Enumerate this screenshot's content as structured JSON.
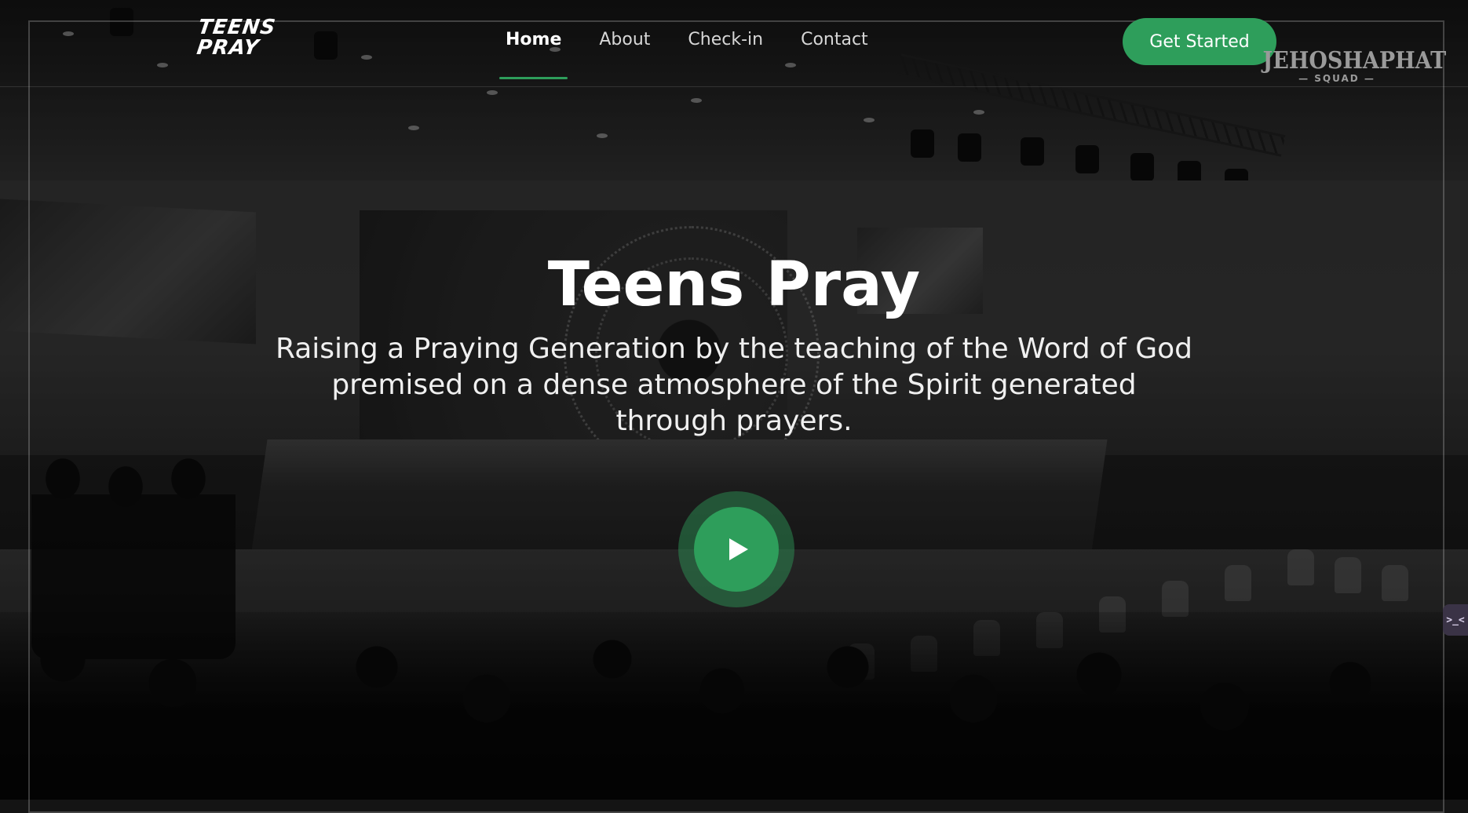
{
  "brand": {
    "logo_line1": "TEENS",
    "logo_line2": "PRAY"
  },
  "nav": {
    "items": [
      {
        "label": "Home",
        "active": true
      },
      {
        "label": "About",
        "active": false
      },
      {
        "label": "Check-in",
        "active": false
      },
      {
        "label": "Contact",
        "active": false
      }
    ]
  },
  "cta": {
    "label": "Get Started"
  },
  "partner": {
    "name": "JEHOSHAPHAT",
    "sub": "— SQUAD —"
  },
  "hero": {
    "title": "Teens Pray",
    "subtitle": "Raising a Praying Generation by the teaching of the Word of God premised on a dense atmosphere of the Spirit generated through prayers."
  },
  "side_widget": {
    "label": ">_<"
  },
  "colors": {
    "accent": "#2e9e5b",
    "text": "#ffffff",
    "nav_text": "#d7d7d7"
  },
  "icons": {
    "play": "play-icon",
    "logo": "teens-pray-logo"
  }
}
